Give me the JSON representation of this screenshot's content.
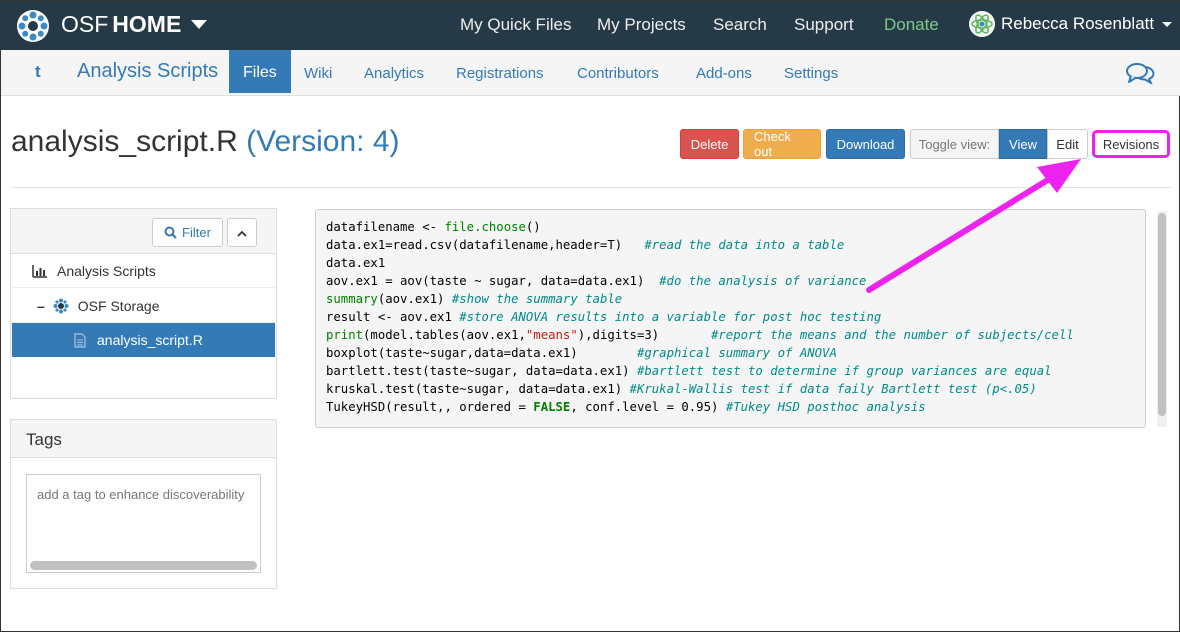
{
  "topnav": {
    "brand_part1": "OSF",
    "brand_part2": "HOME",
    "items": [
      "My Quick Files",
      "My Projects",
      "Search",
      "Support",
      "Donate"
    ],
    "user": "Rebecca Rosenblatt"
  },
  "project": {
    "title": "Analysis Scripts",
    "tabs": [
      "Files",
      "Wiki",
      "Analytics",
      "Registrations",
      "Contributors",
      "Add-ons",
      "Settings"
    ],
    "active_tab": "Files"
  },
  "file": {
    "name": "analysis_script.R",
    "version": "(Version: 4)"
  },
  "actions": {
    "delete": "Delete",
    "checkout": "Check out",
    "download": "Download",
    "toggle_label": "Toggle view:",
    "view": "View",
    "edit": "Edit",
    "revisions": "Revisions"
  },
  "tree": {
    "filter_label": "Filter",
    "rows": [
      "Analysis Scripts",
      "OSF Storage",
      "analysis_script.R"
    ]
  },
  "tags": {
    "title": "Tags",
    "placeholder": "add a tag to enhance discoverability"
  },
  "code": {
    "lines": [
      [
        {
          "t": "datafilename <- ",
          "c": ""
        },
        {
          "t": "file.choose",
          "c": "fn"
        },
        {
          "t": "()",
          "c": ""
        }
      ],
      [
        {
          "t": "data.ex1=read.csv(datafilename,header=T)   ",
          "c": ""
        },
        {
          "t": "#read the data into a table",
          "c": "cm"
        }
      ],
      [
        {
          "t": "data.ex1",
          "c": ""
        }
      ],
      [
        {
          "t": "aov.ex1 = aov(taste ~ sugar, data=data.ex1)  ",
          "c": ""
        },
        {
          "t": "#do the analysis of variance",
          "c": "cm"
        }
      ],
      [
        {
          "t": "summary",
          "c": "fn"
        },
        {
          "t": "(aov.ex1) ",
          "c": ""
        },
        {
          "t": "#show the summary table",
          "c": "cm"
        }
      ],
      [
        {
          "t": "result <- aov.ex1 ",
          "c": ""
        },
        {
          "t": "#store ANOVA results into a variable for post hoc testing",
          "c": "cm"
        }
      ],
      [
        {
          "t": "print",
          "c": "fn"
        },
        {
          "t": "(model.tables(aov.ex1,",
          "c": ""
        },
        {
          "t": "\"means\"",
          "c": "st"
        },
        {
          "t": "),digits=3)       ",
          "c": ""
        },
        {
          "t": "#report the means and the number of subjects/cell",
          "c": "cm"
        }
      ],
      [
        {
          "t": "boxplot(taste~sugar,data=data.ex1)        ",
          "c": ""
        },
        {
          "t": "#graphical summary of ANOVA",
          "c": "cm"
        }
      ],
      [
        {
          "t": "bartlett.test(taste~sugar, data=data.ex1) ",
          "c": ""
        },
        {
          "t": "#bartlett test to determine if group variances are equal",
          "c": "cm"
        }
      ],
      [
        {
          "t": "kruskal.test(taste~sugar, data=data.ex1) ",
          "c": ""
        },
        {
          "t": "#Krukal-Wallis test if data faily Bartlett test (p<.05)",
          "c": "cm"
        }
      ],
      [
        {
          "t": "TukeyHSD(result,, ordered = ",
          "c": ""
        },
        {
          "t": "FALSE",
          "c": "kw"
        },
        {
          "t": ", conf.level = 0.95) ",
          "c": ""
        },
        {
          "t": "#Tukey HSD posthoc analysis",
          "c": "cm"
        }
      ]
    ]
  },
  "colors": {
    "navbar": "#263947",
    "primary": "#337ab7",
    "danger": "#d9534f",
    "warning": "#f0ad4e",
    "annotation": "#ee22ee",
    "donate": "#7fc98b"
  },
  "icons": {
    "logo": "osf-logo-icon",
    "chat": "chat-bubbles-icon",
    "filter": "search-icon",
    "collapse": "chevron-up-icon",
    "project_root": "bar-chart-icon",
    "storage": "osf-storage-icon",
    "file": "file-icon"
  }
}
